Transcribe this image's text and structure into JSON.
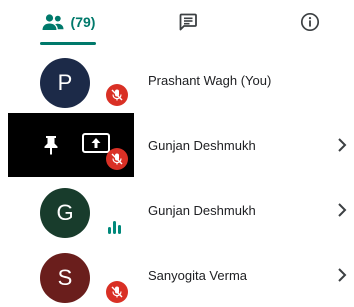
{
  "tabs": {
    "people": {
      "icon": "people-icon",
      "count_label": "(79)",
      "active": true
    },
    "chat": {
      "icon": "chat-icon"
    },
    "info": {
      "icon": "info-icon"
    }
  },
  "colors": {
    "accent": "#00796b",
    "mute_red": "#d93025",
    "speaking_green": "#00897b"
  },
  "participants": [
    {
      "initial": "P",
      "name": "Prashant Wagh (You)",
      "avatar_color": "#1c2a48",
      "muted": true
    },
    {
      "name": "Gunjan Deshmukh",
      "tile": "black",
      "icons": [
        "pin-icon",
        "present-screen-icon"
      ],
      "muted": true
    },
    {
      "initial": "G",
      "name": "Gunjan Deshmukh",
      "avatar_color": "#183c2c",
      "speaking": true
    },
    {
      "initial": "S",
      "name": "Sanyogita Verma",
      "avatar_color": "#6a1e1c",
      "muted": true
    }
  ]
}
